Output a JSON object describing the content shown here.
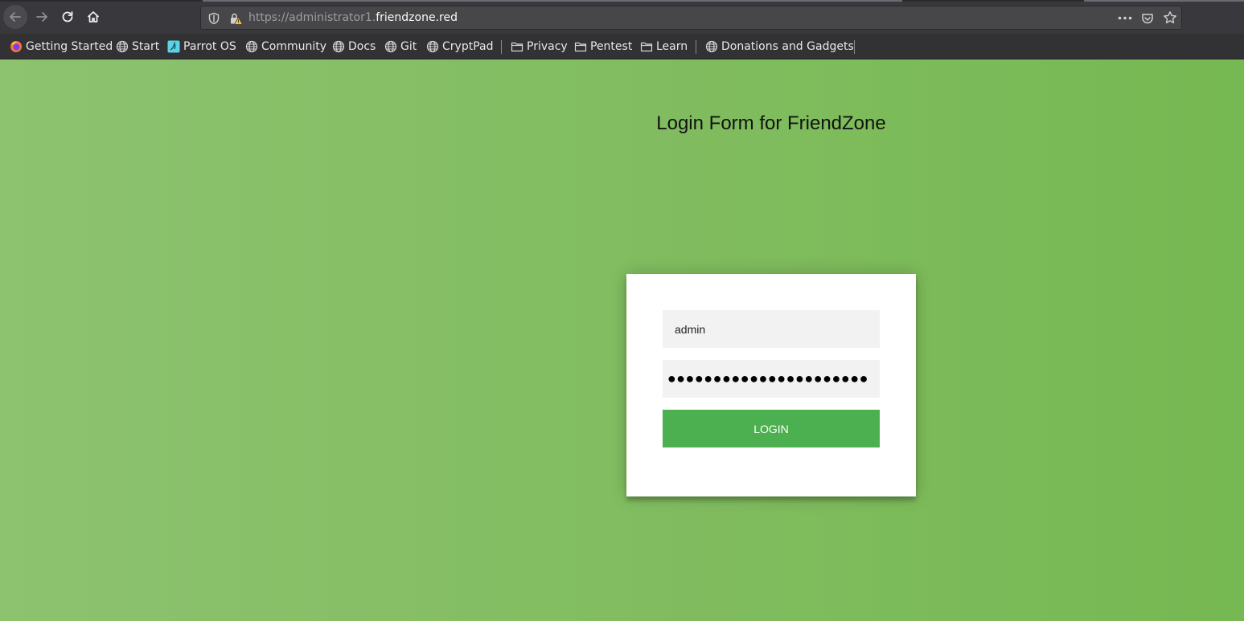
{
  "browser": {
    "url_prefix": "https://administrator1.",
    "url_domain": "friendzone.red",
    "icons": {
      "back": "arrow-left-icon",
      "forward": "arrow-right-icon",
      "reload": "reload-icon",
      "home": "home-icon",
      "tracking": "shield-icon",
      "insecure": "lock-warning-icon",
      "page_actions": "more-icon",
      "pocket": "pocket-icon",
      "bookmark_star": "star-icon"
    }
  },
  "bookmarks": [
    {
      "label": "Getting Started",
      "icon": "firefox-icon"
    },
    {
      "label": "Start",
      "icon": "globe-icon"
    },
    {
      "label": "Parrot OS",
      "icon": "parrot-icon"
    },
    {
      "label": "Community",
      "icon": "globe-icon"
    },
    {
      "label": "Docs",
      "icon": "globe-icon"
    },
    {
      "label": "Git",
      "icon": "globe-icon"
    },
    {
      "label": "CryptPad",
      "icon": "globe-icon"
    },
    {
      "label": "Privacy",
      "icon": "folder-icon"
    },
    {
      "label": "Pentest",
      "icon": "folder-icon"
    },
    {
      "label": "Learn",
      "icon": "folder-icon"
    },
    {
      "label": "Donations and Gadgets",
      "icon": "globe-icon"
    }
  ],
  "page": {
    "title": "Login Form for FriendZone",
    "username_value": "admin",
    "password_masked": "●●●●●●●●●●●●●●●●●●●●●●",
    "login_label": "LOGIN"
  },
  "colors": {
    "background_start": "#8dc26f",
    "background_end": "#76b852",
    "button": "#4caf50"
  }
}
